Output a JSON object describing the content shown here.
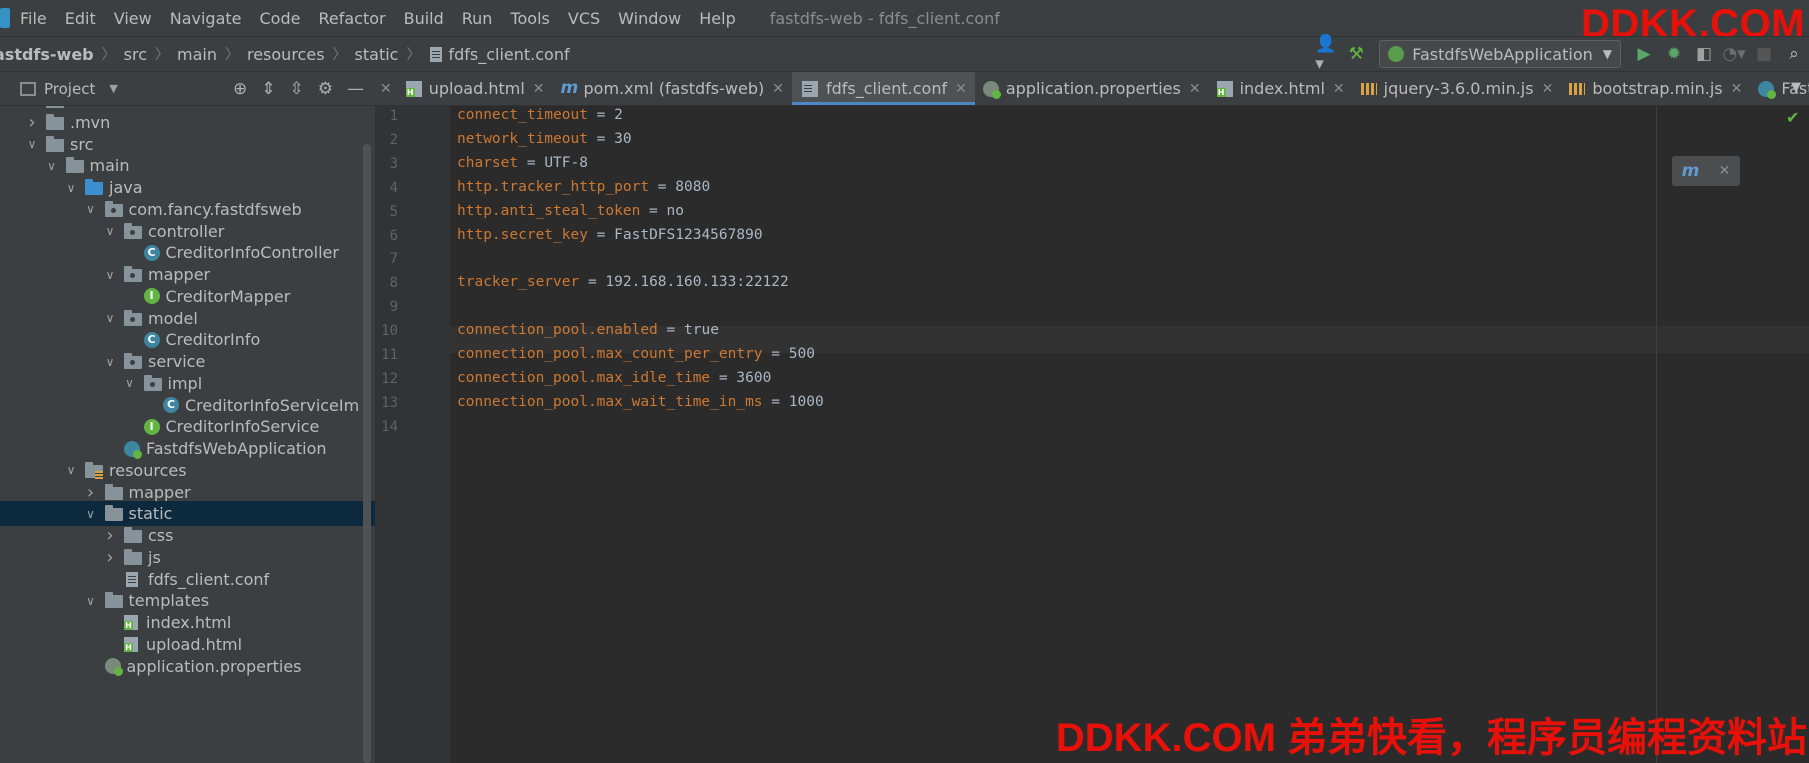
{
  "menubar": {
    "items": [
      "File",
      "Edit",
      "View",
      "Navigate",
      "Code",
      "Refactor",
      "Build",
      "Run",
      "Tools",
      "VCS",
      "Window",
      "Help"
    ],
    "title": "fastdfs-web - fdfs_client.conf",
    "watermark": "DDKK.COM"
  },
  "breadcrumb": [
    "astdfs-web",
    "src",
    "main",
    "resources",
    "static",
    "fdfs_client.conf"
  ],
  "run_config": {
    "label": "FastdfsWebApplication"
  },
  "project_panel": {
    "title": "Project"
  },
  "tree": [
    {
      "label": "idea",
      "depth": 1,
      "icon": "folder",
      "arrow": "right"
    },
    {
      "label": ".mvn",
      "depth": 1,
      "icon": "folder",
      "arrow": "right"
    },
    {
      "label": "src",
      "depth": 1,
      "icon": "folder",
      "arrow": "down"
    },
    {
      "label": "main",
      "depth": 2,
      "icon": "folder",
      "arrow": "down"
    },
    {
      "label": "java",
      "depth": 3,
      "icon": "folder-blue",
      "arrow": "down"
    },
    {
      "label": "com.fancy.fastdfsweb",
      "depth": 4,
      "icon": "package",
      "arrow": "down"
    },
    {
      "label": "controller",
      "depth": 5,
      "icon": "package",
      "arrow": "down"
    },
    {
      "label": "CreditorInfoController",
      "depth": 6,
      "icon": "class",
      "arrow": "none"
    },
    {
      "label": "mapper",
      "depth": 5,
      "icon": "package",
      "arrow": "down"
    },
    {
      "label": "CreditorMapper",
      "depth": 6,
      "icon": "interface",
      "arrow": "none"
    },
    {
      "label": "model",
      "depth": 5,
      "icon": "package",
      "arrow": "down"
    },
    {
      "label": "CreditorInfo",
      "depth": 6,
      "icon": "class",
      "arrow": "none"
    },
    {
      "label": "service",
      "depth": 5,
      "icon": "package",
      "arrow": "down"
    },
    {
      "label": "impl",
      "depth": 6,
      "icon": "package",
      "arrow": "down"
    },
    {
      "label": "CreditorInfoServiceIm",
      "depth": 7,
      "icon": "class",
      "arrow": "none"
    },
    {
      "label": "CreditorInfoService",
      "depth": 6,
      "icon": "interface",
      "arrow": "none"
    },
    {
      "label": "FastdfsWebApplication",
      "depth": 5,
      "icon": "spring",
      "arrow": "none"
    },
    {
      "label": "resources",
      "depth": 3,
      "icon": "resources",
      "arrow": "down"
    },
    {
      "label": "mapper",
      "depth": 4,
      "icon": "folder",
      "arrow": "right"
    },
    {
      "label": "static",
      "depth": 4,
      "icon": "folder",
      "arrow": "down",
      "selected": true
    },
    {
      "label": "css",
      "depth": 5,
      "icon": "folder",
      "arrow": "right"
    },
    {
      "label": "js",
      "depth": 5,
      "icon": "folder",
      "arrow": "right"
    },
    {
      "label": "fdfs_client.conf",
      "depth": 5,
      "icon": "file",
      "arrow": "none"
    },
    {
      "label": "templates",
      "depth": 4,
      "icon": "folder",
      "arrow": "down"
    },
    {
      "label": "index.html",
      "depth": 5,
      "icon": "html",
      "arrow": "none"
    },
    {
      "label": "upload.html",
      "depth": 5,
      "icon": "html",
      "arrow": "none"
    },
    {
      "label": "application.properties",
      "depth": 4,
      "icon": "props",
      "arrow": "none"
    }
  ],
  "tabs": [
    {
      "label": "upload.html",
      "icon": "html"
    },
    {
      "label": "pom.xml (fastdfs-web)",
      "icon": "maven"
    },
    {
      "label": "fdfs_client.conf",
      "icon": "file",
      "active": true
    },
    {
      "label": "application.properties",
      "icon": "props"
    },
    {
      "label": "index.html",
      "icon": "html"
    },
    {
      "label": "jquery-3.6.0.min.js",
      "icon": "js"
    },
    {
      "label": "bootstrap.min.js",
      "icon": "js"
    },
    {
      "label": "Fastdfs",
      "icon": "spring"
    }
  ],
  "editor": {
    "current_line": 9,
    "lines": [
      {
        "n": "1",
        "key": "connect_timeout",
        "val": "2"
      },
      {
        "n": "2",
        "key": "network_timeout",
        "val": "30"
      },
      {
        "n": "3",
        "key": "charset",
        "val": "UTF-8"
      },
      {
        "n": "4",
        "key": "http.tracker_http_port",
        "val": "8080"
      },
      {
        "n": "5",
        "key": "http.anti_steal_token",
        "val": "no"
      },
      {
        "n": "6",
        "key": "http.secret_key",
        "val": "FastDFS1234567890"
      },
      {
        "n": "7",
        "key": "",
        "val": ""
      },
      {
        "n": "8",
        "key": "tracker_server",
        "val": "192.168.160.133:22122"
      },
      {
        "n": "9",
        "key": "",
        "val": ""
      },
      {
        "n": "10",
        "key": "connection_pool.enabled",
        "val": "true"
      },
      {
        "n": "11",
        "key": "connection_pool.max_count_per_entry",
        "val": "500"
      },
      {
        "n": "12",
        "key": "connection_pool.max_idle_time",
        "val": "3600"
      },
      {
        "n": "13",
        "key": "connection_pool.max_wait_time_in_ms",
        "val": "1000"
      },
      {
        "n": "14",
        "key": "",
        "val": ""
      }
    ]
  },
  "watermark_bottom": "DDKK.COM 弟弟快看，程序员编程资料站",
  "colors": {
    "accent": "#4a88c7",
    "keyword": "#cc7832",
    "watermark": "#e8110a"
  }
}
